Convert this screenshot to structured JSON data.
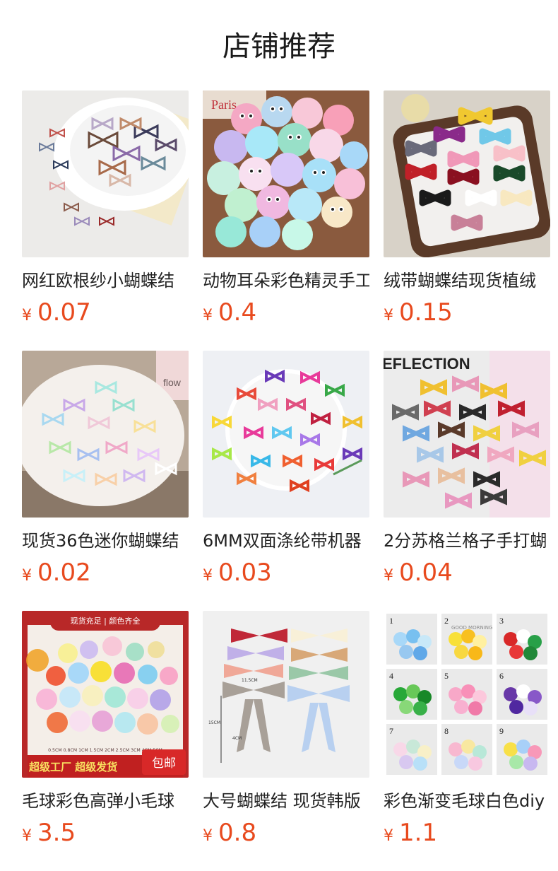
{
  "header": {
    "title": "店铺推荐"
  },
  "products": [
    {
      "name": "网红欧根纱小蝴蝶结",
      "currency": "¥",
      "price": "0.07"
    },
    {
      "name": "动物耳朵彩色精灵手工",
      "currency": "¥",
      "price": "0.4"
    },
    {
      "name": "绒带蝴蝶结现货植绒",
      "currency": "¥",
      "price": "0.15"
    },
    {
      "name": "现货36色迷你蝴蝶结",
      "currency": "¥",
      "price": "0.02"
    },
    {
      "name": "6MM双面涤纶带机器",
      "currency": "¥",
      "price": "0.03"
    },
    {
      "name": "2分苏格兰格子手打蝴",
      "currency": "¥",
      "price": "0.04"
    },
    {
      "name": "毛球彩色高弹小毛球",
      "currency": "¥",
      "price": "3.5"
    },
    {
      "name": "大号蝴蝶结 现货韩版",
      "currency": "¥",
      "price": "0.8"
    },
    {
      "name": "彩色渐变毛球白色diy",
      "currency": "¥",
      "price": "1.1"
    }
  ],
  "image_text": {
    "paris": "Paris",
    "reflection": "EFLECTION",
    "flow": "flow",
    "banner_top": "现货充足 | 颜色齐全",
    "sizes": "0.5CM 0.8CM 1CM 1.5CM 2CM 2.5CM 3CM 4CM 5CM",
    "banner_bottom": "超级工厂 超级发货",
    "badge": "包邮",
    "good_morning": "GOOD MORNING",
    "dims_11": "11.5CM",
    "dims_15": "15CM",
    "dims_4": "4CM"
  }
}
